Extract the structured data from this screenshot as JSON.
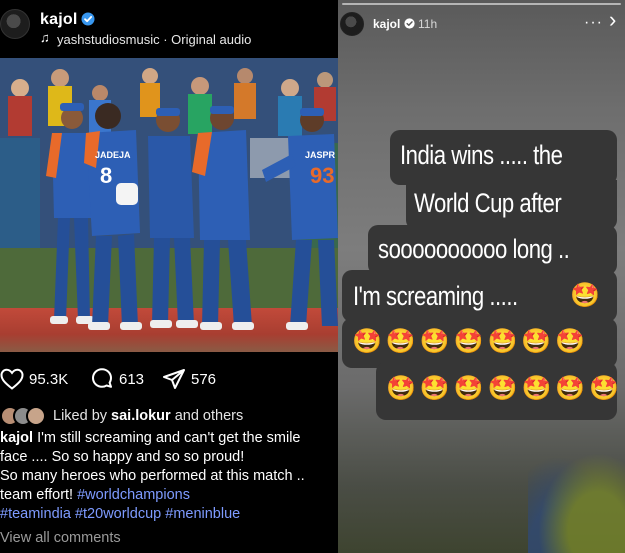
{
  "post": {
    "username": "kajol",
    "audio": "yashstudiosmusic · Original audio",
    "likes": "95.3K",
    "comments": "613",
    "shares": "576",
    "liked_by_prefix": "Liked by ",
    "liked_by_user": "sai.lokur",
    "liked_by_suffix": " and others",
    "caption": {
      "user": "kajol",
      "line1": " I'm still screaming and can't get the smile",
      "line2": "face .... So so happy and so so proud!",
      "line3": "So many heroes who performed at this match ..",
      "line4_text": "team effort! ",
      "hashtag1": "#worldchampions",
      "hashtag2": "#teamindia",
      "hashtag3": "#t20worldcup",
      "hashtag4": "#meninblue"
    },
    "view_comments": "View all comments",
    "jerseys": [
      "JADEJA",
      "8",
      "JASPR",
      "93"
    ]
  },
  "story": {
    "username": "kajol",
    "time": "11h",
    "more": "···",
    "close": "›",
    "lines": [
      "India wins ..... the",
      "World Cup after",
      "soooooooooo long ..",
      "I'm screaming ....."
    ],
    "emoji_row1_trailing": "🤩",
    "emoji_row2": "🤩🤩🤩🤩🤩🤩🤩",
    "emoji_row3": "🤩🤩🤩🤩🤩🤩🤩"
  },
  "colors": {
    "accent_link": "#7e9bff",
    "verified": "#3897f0",
    "jersey_blue": "#2d5fb5",
    "jersey_orange": "#e86a2a"
  }
}
